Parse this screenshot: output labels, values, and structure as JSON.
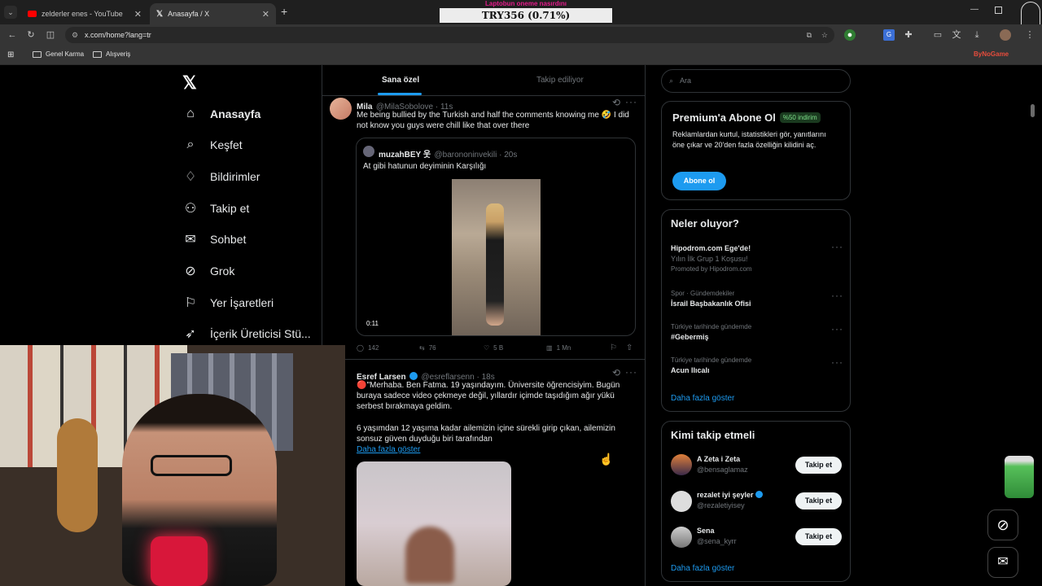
{
  "browser": {
    "tabs": [
      {
        "label": "zelderler enes - YouTube"
      },
      {
        "label": "Anasayfa / X"
      }
    ],
    "url": "x.com/home?lang=tr",
    "bookmarks": [
      "Genel Karma",
      "Alışveriş"
    ],
    "extension_label": "ByNoGame"
  },
  "stream_overlay": {
    "title": "Laptobun oneme nasırdını",
    "donation": "TRY356 (0.71%)"
  },
  "sidebar": {
    "items": [
      {
        "label": "Anasayfa",
        "icon": "home-icon"
      },
      {
        "label": "Keşfet",
        "icon": "search-icon"
      },
      {
        "label": "Bildirimler",
        "icon": "bell-icon"
      },
      {
        "label": "Takip et",
        "icon": "add-user-icon"
      },
      {
        "label": "Sohbet",
        "icon": "mail-icon"
      },
      {
        "label": "Grok",
        "icon": "grok-icon"
      },
      {
        "label": "Yer İşaretleri",
        "icon": "bookmark-icon"
      },
      {
        "label": "İçerik Üreticisi Stü...",
        "icon": "rocket-icon"
      }
    ]
  },
  "timeline": {
    "tabs": [
      "Sana özel",
      "Takip ediliyor"
    ],
    "post1": {
      "name": "Mila",
      "handle": "@MilaSobolove · 11s",
      "text": "Me being bullied by the Turkish and half the comments knowing me 🤣 I did not know you guys were chill like that over there",
      "quote": {
        "name": "muzahBEY 웃",
        "handle": "@barononinvekili · 20s",
        "text": "At gibi hatunun deyiminin Karşılığı",
        "duration": "0:11"
      },
      "stats": {
        "replies": "142",
        "reposts": "76",
        "likes": "5 B",
        "views": "1 Mn"
      }
    },
    "post2": {
      "name": "Esref Larsen",
      "handle": "@esreflarsenn · 18s",
      "text1": "🔴\"Merhaba. Ben Fatma. 19 yaşındayım. Üniversite öğrencisiyim. Bugün buraya sadece video çekmeye değil, yıllardır içimde taşıdığım ağır yükü serbest bırakmaya geldim.",
      "text2": "6 yaşımdan 12 yaşıma kadar ailemizin içine sürekli girip çıkan, ailemizin sonsuz güven duyduğu biri tarafından",
      "show_more": "Daha fazla göster"
    }
  },
  "right": {
    "search_placeholder": "Ara",
    "premium": {
      "title": "Premium'a Abone Ol",
      "badge": "%50 indirim",
      "text": "Reklamlardan kurtul, istatistikleri gör, yanıtlarını öne çıkar ve 20'den fazla özelliğin kilidini aç.",
      "button": "Abone ol"
    },
    "trends": {
      "title": "Neler oluyor?",
      "items": [
        {
          "meta": "",
          "title": "Hipodrom.com Ege'de!",
          "sub": "Yılın İlk Grup 1 Koşusu!",
          "promo": "Promoted by Hipodrom.com"
        },
        {
          "meta": "Spor · Gündemdekiler",
          "title": "İsrail Başbakanlık Ofisi"
        },
        {
          "meta": "Türkiye tarihinde gündemde",
          "title": "#Gebermiş"
        },
        {
          "meta": "Türkiye tarihinde gündemde",
          "title": "Acun Ilıcalı"
        }
      ],
      "show_more": "Daha fazla göster"
    },
    "who_to_follow": {
      "title": "Kimi takip etmeli",
      "items": [
        {
          "name": "A Zeta i Zeta",
          "handle": "@bensaglamaz",
          "button": "Takip et"
        },
        {
          "name": "rezalet iyi şeyler",
          "handle": "@rezaletiyisey",
          "button": "Takip et"
        },
        {
          "name": "Sena",
          "handle": "@sena_kyrr",
          "button": "Takip et"
        }
      ],
      "show_more": "Daha fazla göster"
    }
  },
  "colors": {
    "accent": "#1d9bf0",
    "background": "#000000",
    "border": "#2f3336",
    "muted": "#71767b"
  }
}
